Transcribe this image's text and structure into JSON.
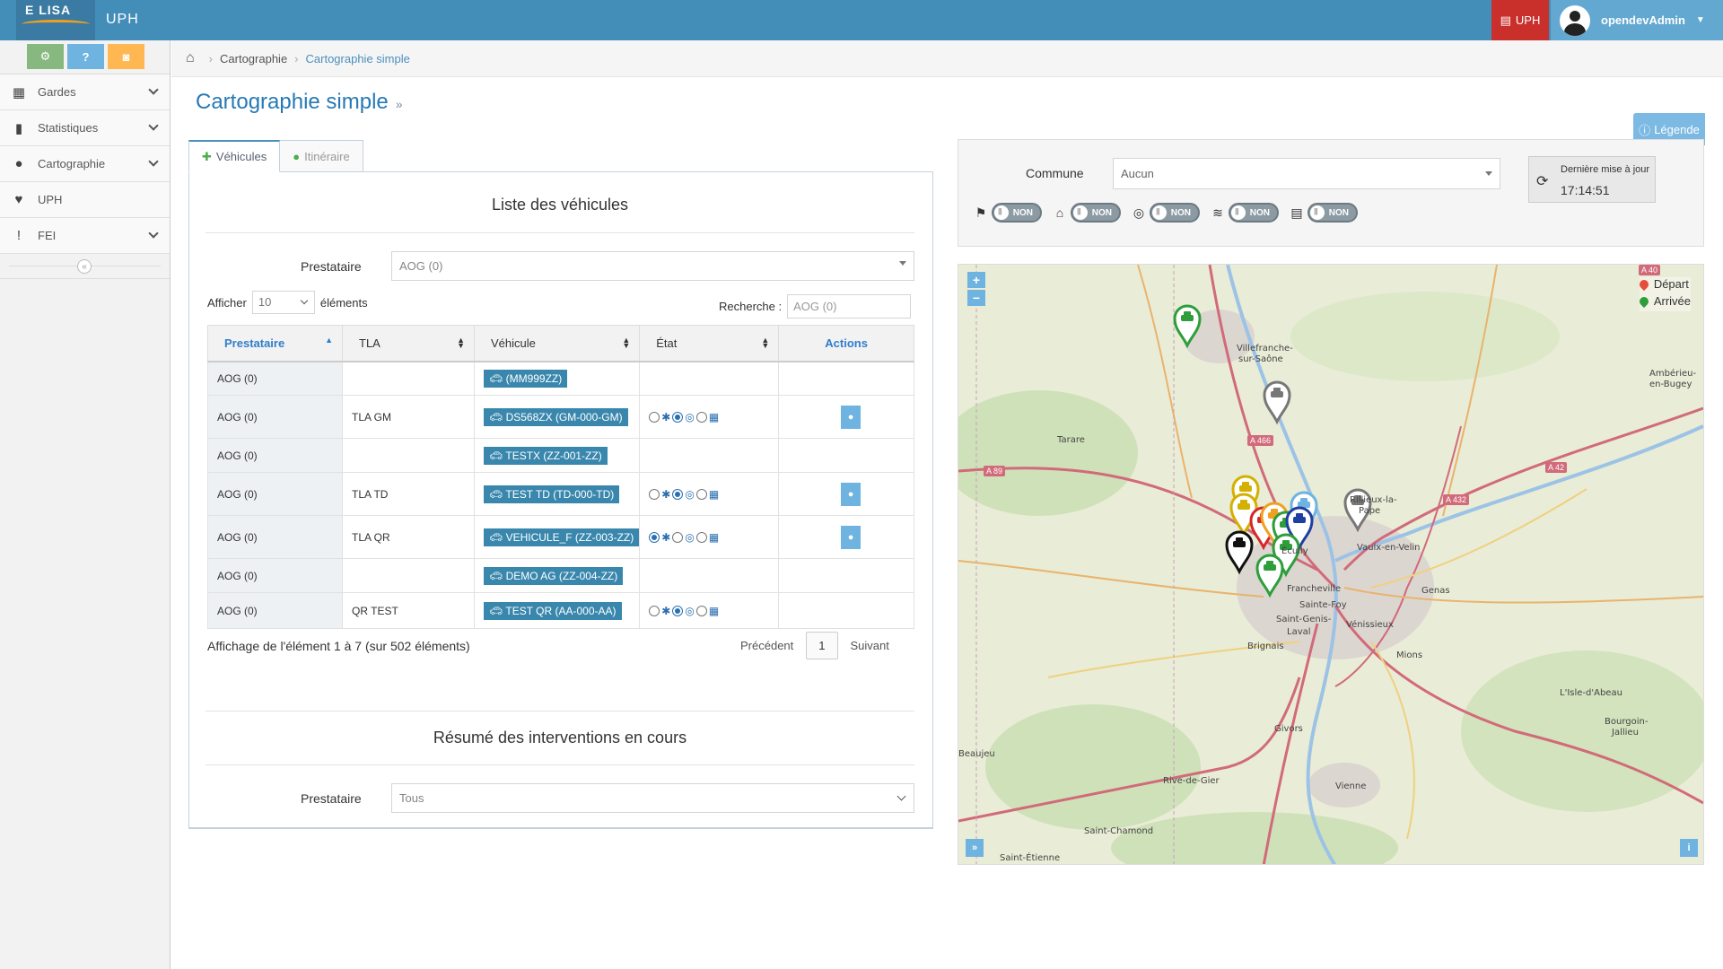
{
  "header": {
    "logo_text": "E LISA",
    "app_title": "UPH",
    "uph_label": "UPH",
    "user_name": "opendevAdmin",
    "colors": {
      "bar": "#438eb9",
      "uph": "#c9302c",
      "user": "#62a8d1"
    }
  },
  "sidebar": {
    "shortcuts": [
      {
        "icon": "cogs-icon",
        "label": "⚙",
        "color": "#87b87f"
      },
      {
        "icon": "question-icon",
        "label": "?",
        "color": "#6fb3e0"
      },
      {
        "icon": "camera-icon",
        "label": "📷",
        "color": "#ffb752"
      }
    ],
    "items": [
      {
        "label": "Gardes",
        "icon": "calendar-icon",
        "glyph": "▦",
        "has_arrow": true
      },
      {
        "label": "Statistiques",
        "icon": "bar-chart-icon",
        "glyph": "▮",
        "has_arrow": true
      },
      {
        "label": "Cartographie",
        "icon": "map-marker-icon",
        "glyph": "●",
        "has_arrow": true
      },
      {
        "label": "UPH",
        "icon": "heartbeat-icon",
        "glyph": "♥",
        "has_arrow": false
      },
      {
        "label": "FEI",
        "icon": "exclamation-circle-icon",
        "glyph": "!",
        "has_arrow": true
      }
    ],
    "collapse_glyph": "«"
  },
  "breadcrumb": {
    "items": [
      "Cartographie",
      "Cartographie simple"
    ]
  },
  "page": {
    "title": "Cartographie simple",
    "title_suffix": "»",
    "legend_button": "Légende"
  },
  "tabs": [
    {
      "label": "Véhicules",
      "icon": "ambulance-icon",
      "active": true
    },
    {
      "label": "Itinéraire",
      "icon": "map-marker-icon",
      "active": false
    }
  ],
  "vehicles": {
    "title": "Liste des véhicules",
    "prestataire_label": "Prestataire",
    "prestataire_value": "AOG (0)",
    "show_label": "Afficher",
    "show_value": "10",
    "elements_label": "éléments",
    "search_label": "Recherche :",
    "search_value": "AOG (0)",
    "columns": [
      "Prestataire",
      "TLA",
      "Véhicule",
      "État",
      "Actions"
    ],
    "rows": [
      {
        "prestataire": "AOG (0)",
        "tla": "",
        "vehicule": "(MM999ZZ)",
        "etat": null,
        "action": false
      },
      {
        "prestataire": "AOG (0)",
        "tla": "TLA GM",
        "vehicule": "DS568ZX (GM-000-GM)",
        "etat": 1,
        "action": true
      },
      {
        "prestataire": "AOG (0)",
        "tla": "",
        "vehicule": "TESTX (ZZ-001-ZZ)",
        "etat": null,
        "action": false
      },
      {
        "prestataire": "AOG (0)",
        "tla": "TLA TD",
        "vehicule": "TEST TD (TD-000-TD)",
        "etat": 1,
        "action": true
      },
      {
        "prestataire": "AOG (0)",
        "tla": "TLA QR",
        "vehicule": "VEHICULE_F (ZZ-003-ZZ)",
        "etat": 0,
        "action": true
      },
      {
        "prestataire": "AOG (0)",
        "tla": "",
        "vehicule": "DEMO AG (ZZ-004-ZZ)",
        "etat": null,
        "action": false
      },
      {
        "prestataire": "AOG (0)",
        "tla": "QR TEST",
        "vehicule": "TEST QR (AA-000-AA)",
        "etat": 1,
        "action": false
      }
    ],
    "info": "Affichage de l'élément 1 à 7 (sur 502 éléments)",
    "pager": {
      "prev": "Précédent",
      "current": "1",
      "next": "Suivant"
    }
  },
  "interventions": {
    "title": "Résumé des interventions en cours",
    "prestataire_label": "Prestataire",
    "prestataire_value": "Tous"
  },
  "filters": {
    "commune_label": "Commune",
    "commune_value": "Aucun",
    "toggles": [
      {
        "icon": "road-sign-icon",
        "glyph": "⚑",
        "state": "NON"
      },
      {
        "icon": "home-icon",
        "glyph": "⌂",
        "state": "NON"
      },
      {
        "icon": "eye-slash-icon",
        "glyph": "◎",
        "state": "NON"
      },
      {
        "icon": "rss-icon",
        "glyph": "≋",
        "state": "NON"
      },
      {
        "icon": "clipboard-icon",
        "glyph": "▤",
        "state": "NON"
      }
    ],
    "last_update_label": "Dernière mise à jour",
    "last_update_time": "17:14:51"
  },
  "map": {
    "legend": [
      {
        "label": "Départ",
        "color": "#e74c3c"
      },
      {
        "label": "Arrivée",
        "color": "#2e9e3b"
      }
    ],
    "zoom_in": "+",
    "zoom_out": "−",
    "places": [
      "Villefranche-",
      "sur-Saône",
      "Tarare",
      "Rillieux-la-",
      "Pape",
      "Vaulx-en-Velin",
      "Genas",
      "Francheville",
      "Écully",
      "Sainte-Foy",
      "Saint-Genis-",
      "Laval",
      "Vénissieux",
      "Brignais",
      "Mions",
      "Givors",
      "L'Isle-d'Abeau",
      "Bourgoin-",
      "Jallieu",
      "Ambérieu-",
      "en-Bugey",
      "Rive-de-Gier",
      "Vienne",
      "Saint-Chamond",
      "Saint-Étienne",
      "Beaujeu"
    ],
    "roads": [
      "A 40",
      "A 466",
      "A 89",
      "A 42",
      "A 432"
    ]
  }
}
